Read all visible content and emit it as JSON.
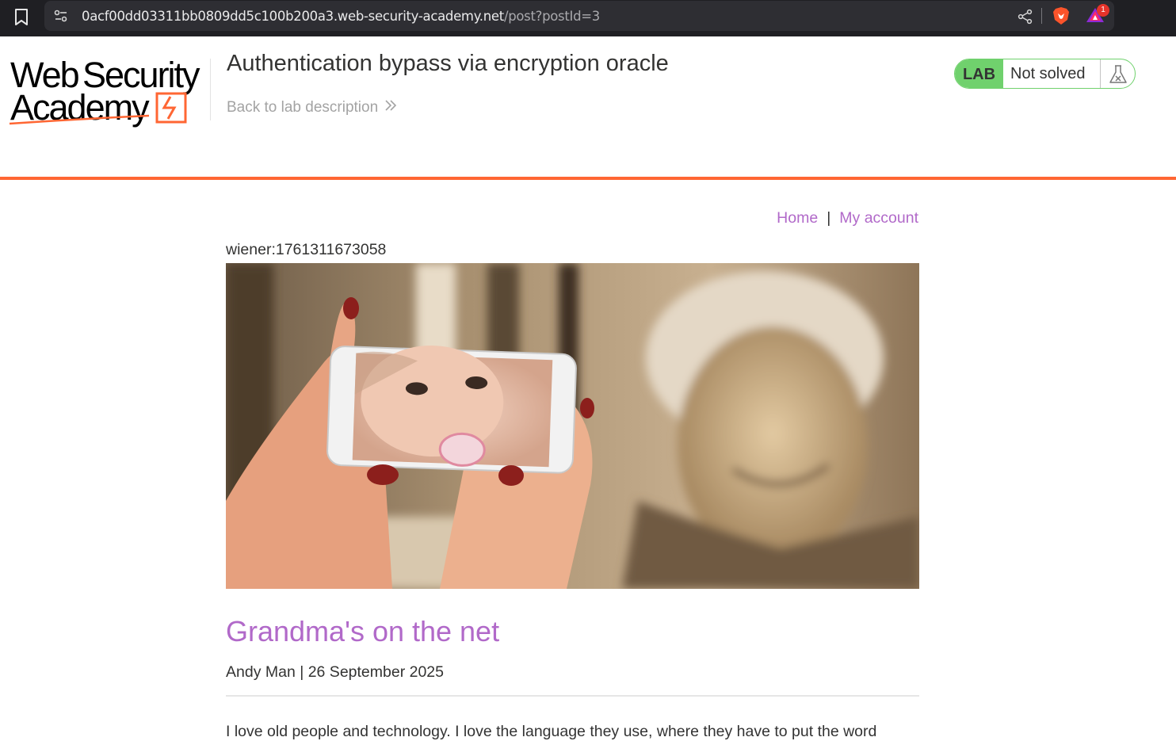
{
  "browser": {
    "url_host": "0acf00dd03311bb0809dd5c100b200a3.web-security-academy.net",
    "url_path": "/post?postId=3",
    "rewards_count": "1"
  },
  "header": {
    "logo_alt": "Web Security Academy",
    "lab_title": "Authentication bypass via encryption oracle",
    "back_link": "Back to lab description",
    "lab_badge": "LAB",
    "lab_status": "Not solved"
  },
  "nav": {
    "home": "Home",
    "separator": "|",
    "account": "My account"
  },
  "post": {
    "session_text": "wiener:1761311673058",
    "image_alt": "Hands holding a phone showing a baby in front of a smiling grandmother",
    "title": "Grandma's on the net",
    "author_date": "Andy Man | 26 September 2025",
    "body_preview": "I love old people and technology. I love the language they use, where they have to put the word"
  },
  "colors": {
    "accent_orange": "#ff6633",
    "link_purple": "#b169c9",
    "lab_green": "#70d16d"
  }
}
